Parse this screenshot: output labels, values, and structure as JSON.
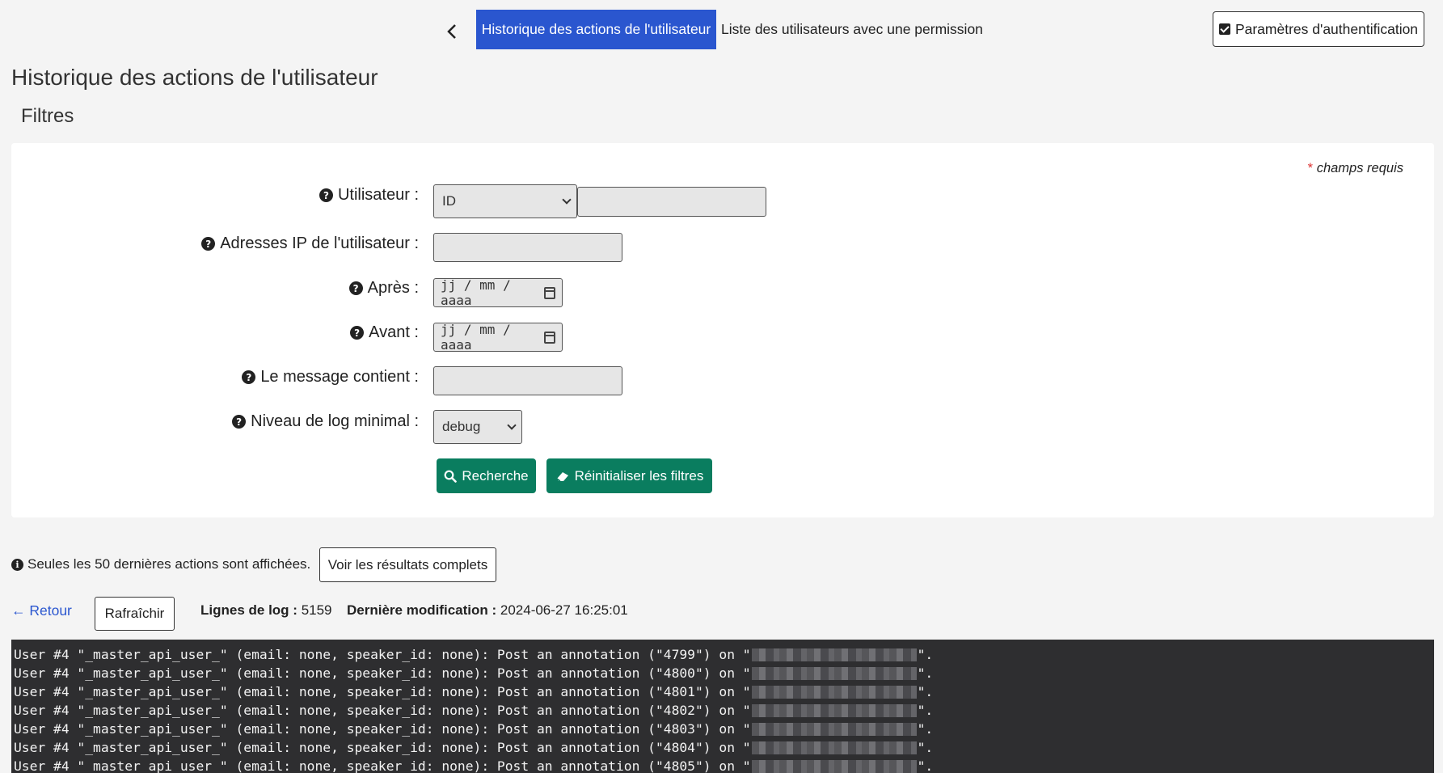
{
  "nav": {
    "active_tab": "Historique des actions de l'utilisateur",
    "tab2": "Liste des utilisateurs avec une permission",
    "auth_button": "Paramètres d'authentification"
  },
  "page_title": "Historique des actions de l'utilisateur",
  "filters": {
    "title": "Filtres",
    "required_star": "*",
    "required_note": "champs requis",
    "user_label": "Utilisateur :",
    "user_select_value": "ID",
    "ip_label": "Adresses IP de l'utilisateur :",
    "after_label": "Après :",
    "before_label": "Avant :",
    "date_placeholder": "jj / mm / aaaa",
    "message_label": "Le message contient :",
    "level_label": "Niveau de log minimal :",
    "level_value": "debug",
    "search_button": "Recherche",
    "reset_button": "Réinitialiser les filtres"
  },
  "info": {
    "text": "Seules les 50 dernières actions sont affichées.",
    "full_results_button": "Voir les résultats complets"
  },
  "toolbar": {
    "back_link": "← Retour",
    "refresh_button": "Rafraîchir",
    "log_lines_label": "Lignes de log :",
    "log_lines_value": "5159",
    "last_modified_label": "Dernière modification :",
    "last_modified_value": "2024-06-27 16:25:01"
  },
  "log": [
    {
      "prefix": "User #4 \"_master_api_user_\" (email: none, speaker_id: none): Post an annotation (\"4799\") on \"",
      "suffix": "\"."
    },
    {
      "prefix": "User #4 \"_master_api_user_\" (email: none, speaker_id: none): Post an annotation (\"4800\") on \"",
      "suffix": "\"."
    },
    {
      "prefix": "User #4 \"_master_api_user_\" (email: none, speaker_id: none): Post an annotation (\"4801\") on \"",
      "suffix": "\"."
    },
    {
      "prefix": "User #4 \"_master_api_user_\" (email: none, speaker_id: none): Post an annotation (\"4802\") on \"",
      "suffix": "\"."
    },
    {
      "prefix": "User #4 \"_master_api_user_\" (email: none, speaker_id: none): Post an annotation (\"4803\") on \"",
      "suffix": "\"."
    },
    {
      "prefix": "User #4 \"_master_api_user_\" (email: none, speaker_id: none): Post an annotation (\"4804\") on \"",
      "suffix": "\"."
    },
    {
      "prefix": "User #4 \"_master_api_user_\" (email: none, speaker_id: none): Post an annotation (\"4805\") on \"",
      "suffix": "\"."
    }
  ]
}
